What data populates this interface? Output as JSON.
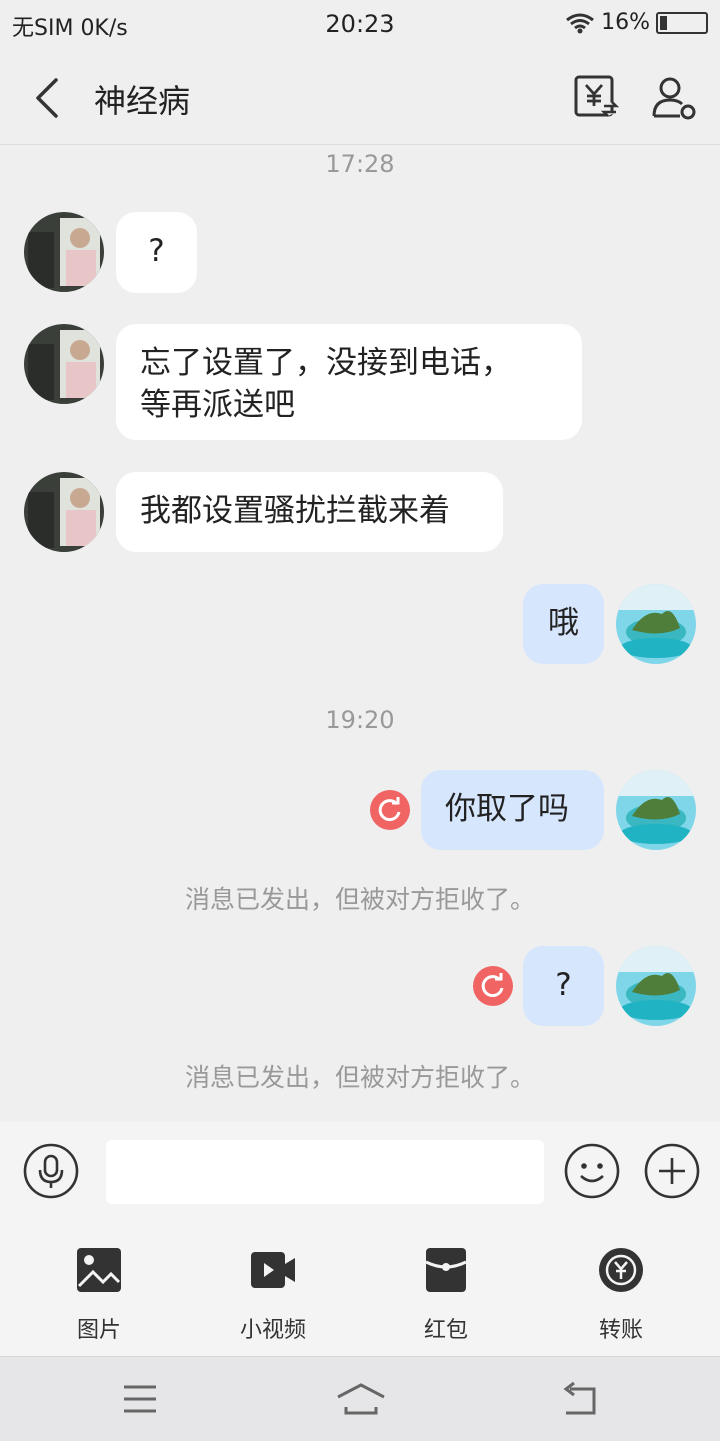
{
  "status_bar": {
    "sim": "无SIM",
    "speed": "0K/s",
    "time": "20:23",
    "battery": "16%",
    "battery_level": 0.16
  },
  "header": {
    "title": "神经病"
  },
  "messages": {
    "ts1": "17:28",
    "m1": "?",
    "m2_line1": "忘了设置了，没接到电话，",
    "m2_line2": "等再派送吧",
    "m3": "我都设置骚扰拦截来着",
    "m4": "哦",
    "ts2": "19:20",
    "m5": "你取了吗",
    "sys1": "消息已发出，但被对方拒收了。",
    "m6": "?",
    "sys2": "消息已发出，但被对方拒收了。"
  },
  "tools": {
    "image": "图片",
    "video": "小视频",
    "redpacket": "红包",
    "transfer": "转账"
  },
  "colors": {
    "outgoing_bubble": "#d6e6fd",
    "incoming_bubble": "#ffffff",
    "failed_badge": "#f06464"
  }
}
